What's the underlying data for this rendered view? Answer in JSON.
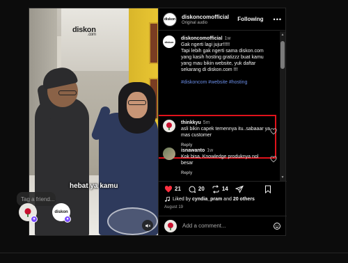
{
  "media": {
    "watermark": "diskon",
    "watermark_sub": ".com",
    "overlay_text": "hebat ya kamu",
    "tag_placeholder": "Tag a friend...",
    "tag_brand": "diskon"
  },
  "post": {
    "username": "diskoncomofficial",
    "audio": "Original audio",
    "follow_label": "Following",
    "more_label": "•••"
  },
  "comments": [
    {
      "user": "diskoncomofficial",
      "time": "1w",
      "lines": [
        "Gak ngerti lagi jujur!!!!!",
        "Tapi lebih gak ngerti sama diskon.com yang kasih hosting gratizzz  buat kamu yang mau bikin website, yuk daftar sekarang di diskon.com !!!"
      ],
      "hashtags": "#diskoncom #website #hosting"
    },
    {
      "user": "thinkkyu",
      "time": "5m",
      "text": "asli bikin capek temennya itu..sabaaar ya mas customer",
      "reply": "Reply"
    },
    {
      "user": "isnawanto",
      "time": "1w",
      "text": "Kok bisa, Knowledge produknya nol besar",
      "reply": "Reply"
    }
  ],
  "actions": {
    "likes": "21",
    "comments": "20",
    "shares": "14"
  },
  "liked_by": {
    "prefix": "Liked by",
    "user": "cyndia_pram",
    "middle": "and",
    "others": "20 others"
  },
  "date": "August 19",
  "add_comment_placeholder": "Add a comment...",
  "colors": {
    "like_red": "#ff3040",
    "highlight_red": "#e0121b",
    "hashtag_blue": "#6b8ee8"
  }
}
